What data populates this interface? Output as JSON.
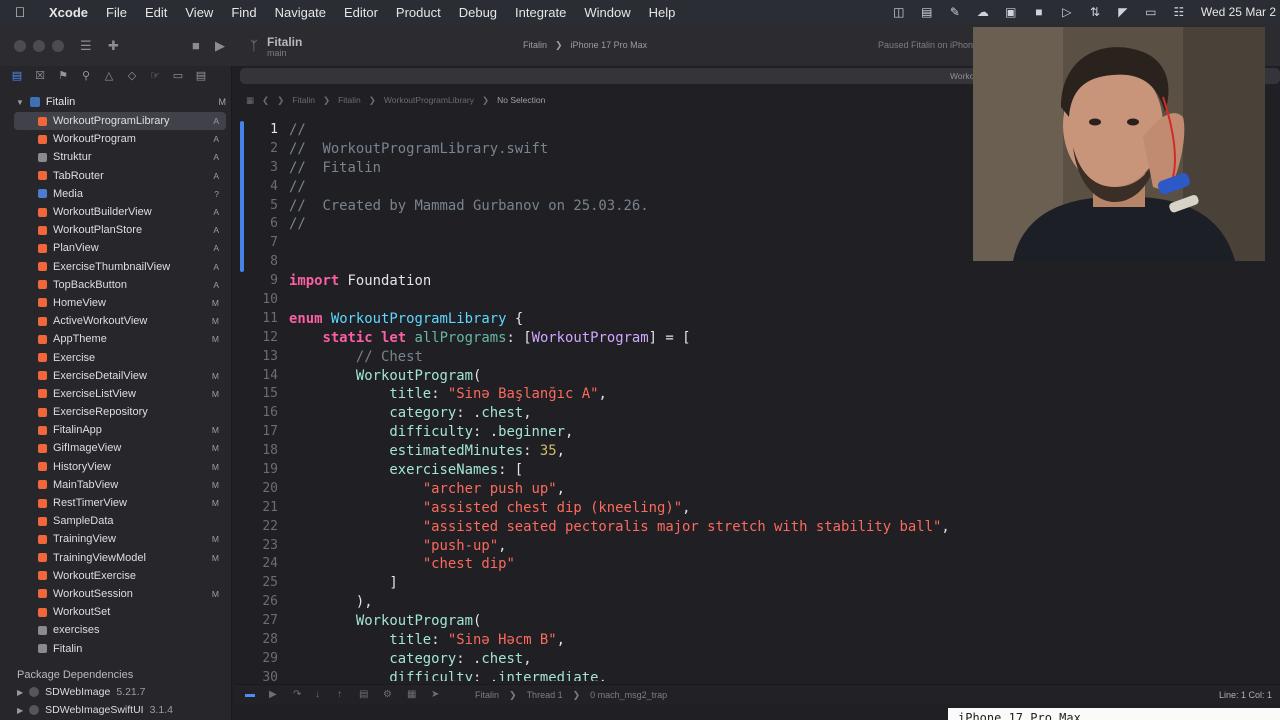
{
  "menubar": {
    "app_name": "Xcode",
    "menus": [
      "File",
      "Edit",
      "View",
      "Find",
      "Navigate",
      "Editor",
      "Product",
      "Debug",
      "Integrate",
      "Window",
      "Help"
    ],
    "clock": "Wed 25 Mar 2"
  },
  "toolbar": {
    "scheme_title": "Fitalin",
    "scheme_branch": "main",
    "scheme_name": "Fitalin",
    "run_destination": "iPhone 17 Pro Max",
    "run_status": "Paused Fitalin on iPhone"
  },
  "navigator": {
    "project": {
      "name": "Fitalin",
      "badge": "M"
    },
    "files": [
      {
        "name": "WorkoutProgramLibrary",
        "badge": "A",
        "kind": "swift",
        "selected": true
      },
      {
        "name": "WorkoutProgram",
        "badge": "A",
        "kind": "swift"
      },
      {
        "name": "Struktur",
        "badge": "A",
        "kind": "file"
      },
      {
        "name": "TabRouter",
        "badge": "A",
        "kind": "swift"
      },
      {
        "name": "Media",
        "badge": "?",
        "kind": "folder"
      },
      {
        "name": "WorkoutBuilderView",
        "badge": "A",
        "kind": "swift"
      },
      {
        "name": "WorkoutPlanStore",
        "badge": "A",
        "kind": "swift"
      },
      {
        "name": "PlanView",
        "badge": "A",
        "kind": "swift"
      },
      {
        "name": "ExerciseThumbnailView",
        "badge": "A",
        "kind": "swift"
      },
      {
        "name": "TopBackButton",
        "badge": "A",
        "kind": "swift"
      },
      {
        "name": "HomeView",
        "badge": "M",
        "kind": "swift"
      },
      {
        "name": "ActiveWorkoutView",
        "badge": "M",
        "kind": "swift"
      },
      {
        "name": "AppTheme",
        "badge": "M",
        "kind": "swift"
      },
      {
        "name": "Exercise",
        "badge": "",
        "kind": "swift"
      },
      {
        "name": "ExerciseDetailView",
        "badge": "M",
        "kind": "swift"
      },
      {
        "name": "ExerciseListView",
        "badge": "M",
        "kind": "swift"
      },
      {
        "name": "ExerciseRepository",
        "badge": "",
        "kind": "swift"
      },
      {
        "name": "FitalinApp",
        "badge": "M",
        "kind": "swift"
      },
      {
        "name": "GifImageView",
        "badge": "M",
        "kind": "swift"
      },
      {
        "name": "HistoryView",
        "badge": "M",
        "kind": "swift"
      },
      {
        "name": "MainTabView",
        "badge": "M",
        "kind": "swift"
      },
      {
        "name": "RestTimerView",
        "badge": "M",
        "kind": "swift"
      },
      {
        "name": "SampleData",
        "badge": "",
        "kind": "swift"
      },
      {
        "name": "TrainingView",
        "badge": "M",
        "kind": "swift"
      },
      {
        "name": "TrainingViewModel",
        "badge": "M",
        "kind": "swift"
      },
      {
        "name": "WorkoutExercise",
        "badge": "",
        "kind": "swift"
      },
      {
        "name": "WorkoutSession",
        "badge": "M",
        "kind": "swift"
      },
      {
        "name": "WorkoutSet",
        "badge": "",
        "kind": "swift"
      },
      {
        "name": "exercises",
        "badge": "",
        "kind": "json"
      },
      {
        "name": "Fitalin",
        "badge": "",
        "kind": "file"
      }
    ],
    "package_header": "Package Dependencies",
    "packages": [
      {
        "name": "SDWebImage",
        "version": "5.21.7"
      },
      {
        "name": "SDWebImageSwiftUI",
        "version": "3.1.4"
      }
    ]
  },
  "editor": {
    "tab_label": "WorkoutProgramLibrary",
    "jumpbar": [
      "Fitalin",
      "Fitalin",
      "WorkoutProgramLibrary",
      "No Selection"
    ],
    "current_line": 1,
    "lines": [
      [
        [
          "cm",
          "//"
        ]
      ],
      [
        [
          "cm",
          "//  WorkoutProgramLibrary.swift"
        ]
      ],
      [
        [
          "cm",
          "//  Fitalin"
        ]
      ],
      [
        [
          "cm",
          "//"
        ]
      ],
      [
        [
          "cm",
          "//  Created by Mammad Gurbanov on 25.03.26."
        ]
      ],
      [
        [
          "cm",
          "//"
        ]
      ],
      [],
      [],
      [
        [
          "kw",
          "import"
        ],
        [
          "tx",
          " Foundation"
        ]
      ],
      [],
      [
        [
          "kw",
          "enum"
        ],
        [
          "tx",
          " "
        ],
        [
          "ty",
          "WorkoutProgramLibrary"
        ],
        [
          "tx",
          " {"
        ]
      ],
      [
        [
          "tx",
          "    "
        ],
        [
          "kw",
          "static"
        ],
        [
          "tx",
          " "
        ],
        [
          "kw",
          "let"
        ],
        [
          "tx",
          " "
        ],
        [
          "fn",
          "allPrograms"
        ],
        [
          "tx",
          ": ["
        ],
        [
          "tyd",
          "WorkoutProgram"
        ],
        [
          "tx",
          "] = ["
        ]
      ],
      [
        [
          "tx",
          "        "
        ],
        [
          "cm",
          "// Chest"
        ]
      ],
      [
        [
          "tx",
          "        "
        ],
        [
          "pl",
          "WorkoutProgram"
        ],
        [
          "tx",
          "("
        ]
      ],
      [
        [
          "tx",
          "            "
        ],
        [
          "pl",
          "title"
        ],
        [
          "tx",
          ": "
        ],
        [
          "st",
          "\"Sinə Başlanğıc A\""
        ],
        [
          "tx",
          ","
        ]
      ],
      [
        [
          "tx",
          "            "
        ],
        [
          "pl",
          "category"
        ],
        [
          "tx",
          ": ."
        ],
        [
          "pl",
          "chest"
        ],
        [
          "tx",
          ","
        ]
      ],
      [
        [
          "tx",
          "            "
        ],
        [
          "pl",
          "difficulty"
        ],
        [
          "tx",
          ": ."
        ],
        [
          "pl",
          "beginner"
        ],
        [
          "tx",
          ","
        ]
      ],
      [
        [
          "tx",
          "            "
        ],
        [
          "pl",
          "estimatedMinutes"
        ],
        [
          "tx",
          ": "
        ],
        [
          "nm",
          "35"
        ],
        [
          "tx",
          ","
        ]
      ],
      [
        [
          "tx",
          "            "
        ],
        [
          "pl",
          "exerciseNames"
        ],
        [
          "tx",
          ": ["
        ]
      ],
      [
        [
          "tx",
          "                "
        ],
        [
          "st",
          "\"archer push up\""
        ],
        [
          "tx",
          ","
        ]
      ],
      [
        [
          "tx",
          "                "
        ],
        [
          "st",
          "\"assisted chest dip (kneeling)\""
        ],
        [
          "tx",
          ","
        ]
      ],
      [
        [
          "tx",
          "                "
        ],
        [
          "st",
          "\"assisted seated pectoralis major stretch with stability ball\""
        ],
        [
          "tx",
          ","
        ]
      ],
      [
        [
          "tx",
          "                "
        ],
        [
          "st",
          "\"push-up\""
        ],
        [
          "tx",
          ","
        ]
      ],
      [
        [
          "tx",
          "                "
        ],
        [
          "st",
          "\"chest dip\""
        ]
      ],
      [
        [
          "tx",
          "            ]"
        ]
      ],
      [
        [
          "tx",
          "        ),"
        ]
      ],
      [
        [
          "tx",
          "        "
        ],
        [
          "pl",
          "WorkoutProgram"
        ],
        [
          "tx",
          "("
        ]
      ],
      [
        [
          "tx",
          "            "
        ],
        [
          "pl",
          "title"
        ],
        [
          "tx",
          ": "
        ],
        [
          "st",
          "\"Sinə Həcm B\""
        ],
        [
          "tx",
          ","
        ]
      ],
      [
        [
          "tx",
          "            "
        ],
        [
          "pl",
          "category"
        ],
        [
          "tx",
          ": ."
        ],
        [
          "pl",
          "chest"
        ],
        [
          "tx",
          ","
        ]
      ],
      [
        [
          "tx",
          "            "
        ],
        [
          "pl",
          "difficulty"
        ],
        [
          "tx",
          ": ."
        ],
        [
          "pl",
          "intermediate"
        ],
        [
          "tx",
          ","
        ]
      ]
    ]
  },
  "debugbar": {
    "path": [
      "Fitalin",
      "Thread 1",
      "0 mach_msg2_trap"
    ],
    "cursor": "Line: 1  Col: 1"
  },
  "console": {
    "text": "iPhone 17 Pro Max"
  },
  "colors": {
    "accent": "#4d8df7",
    "selection": "#414149",
    "swift_icon": "#f0673a"
  }
}
